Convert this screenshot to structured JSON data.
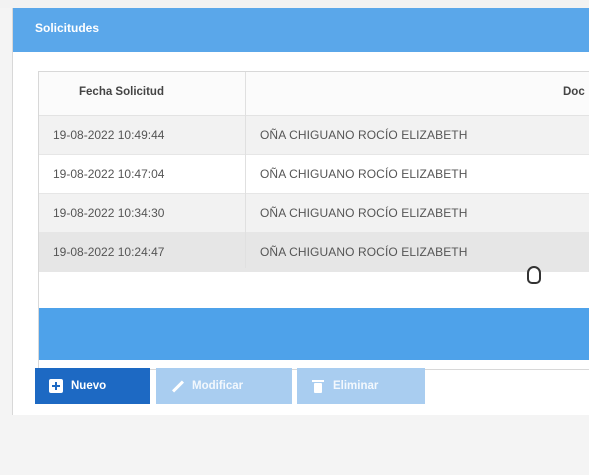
{
  "panel": {
    "title": "Solicitudes"
  },
  "table": {
    "columns": [
      "Fecha Solicitud",
      "Doc"
    ],
    "rows": [
      {
        "date": "19-08-2022 10:49:44",
        "name": "OÑA CHIGUANO ROCÍO ELIZABETH"
      },
      {
        "date": "19-08-2022 10:47:04",
        "name": "OÑA CHIGUANO ROCÍO ELIZABETH"
      },
      {
        "date": "19-08-2022 10:34:30",
        "name": "OÑA CHIGUANO ROCÍO ELIZABETH"
      },
      {
        "date": "19-08-2022 10:24:47",
        "name": "OÑA CHIGUANO ROCÍO ELIZABETH"
      }
    ]
  },
  "toolbar": {
    "new_label": "Nuevo",
    "edit_label": "Modificar",
    "delete_label": "Eliminar"
  },
  "colors": {
    "header": "#5aa7ea",
    "primary": "#1d69c3",
    "disabled": "#a9cdf0"
  },
  "icons": [
    "plus-icon",
    "pencil-icon",
    "trash-icon",
    "hand-cursor-icon"
  ]
}
